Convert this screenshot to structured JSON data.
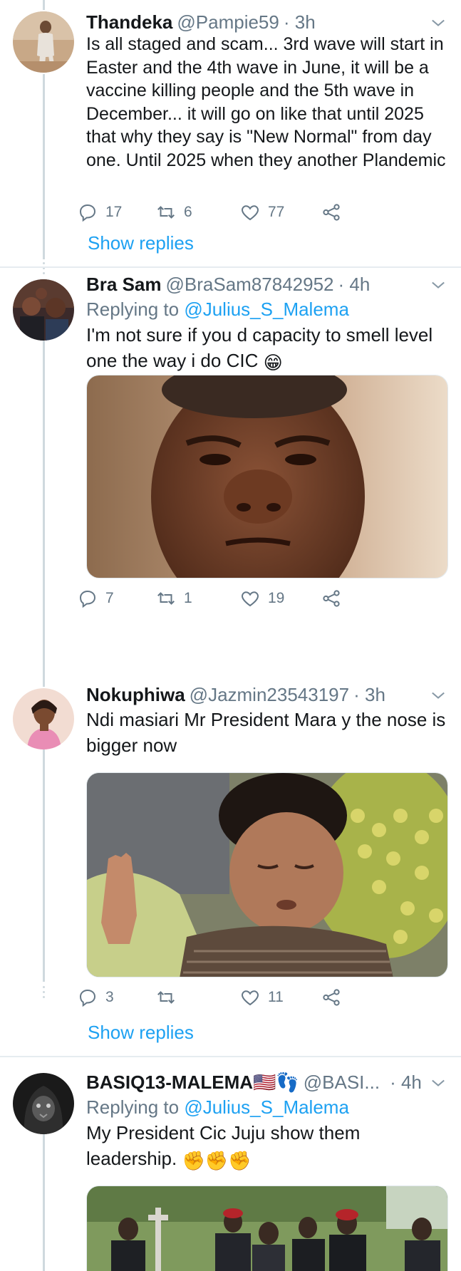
{
  "tweets": [
    {
      "name": "Thandeka",
      "handle": "@Pampie59",
      "time": "· 3h",
      "text": "Is all staged and scam... 3rd wave will start in Easter and the 4th wave in June, it will be a vaccine killing people and the 5th wave in December... it will go on like that until 2025 that why they say is \"New Normal\" from day one. Until 2025 when they another Plandemic",
      "replies": "17",
      "retweets": "6",
      "likes": "77",
      "show_replies": "Show replies"
    },
    {
      "name": "Bra Sam",
      "handle": "@BraSam87842952",
      "time": "· 4h",
      "replying_prefix": "Replying to ",
      "replying_to": "@Julius_S_Malema",
      "text": "I'm not sure if you d capacity to smell level one the way i do CIC",
      "emoji": "😁",
      "replies": "7",
      "retweets": "1",
      "likes": "19"
    },
    {
      "name": "Nokuphiwa",
      "handle": "@Jazmin23543197",
      "time": "· 3h",
      "text": "Ndi masiari Mr President Mara y the nose is bigger now",
      "replies": "3",
      "retweets": "",
      "likes": "11",
      "show_replies": "Show replies"
    },
    {
      "name": "BASIQ13-MALEMA🇺🇸👣",
      "handle": "@BASI...",
      "time": "· 4h",
      "replying_prefix": "Replying to ",
      "replying_to": "@Julius_S_Malema",
      "text": "My President Cic Juju show them leadership.",
      "emoji": "✊✊✊"
    }
  ],
  "icons": {
    "reply": "reply-icon",
    "retweet": "retweet-icon",
    "like": "heart-icon",
    "share": "share-icon",
    "menu": "chevron-down-icon"
  },
  "colors": {
    "link": "#1da1f2",
    "secondary": "#657786",
    "divider": "#e6ecf0"
  }
}
